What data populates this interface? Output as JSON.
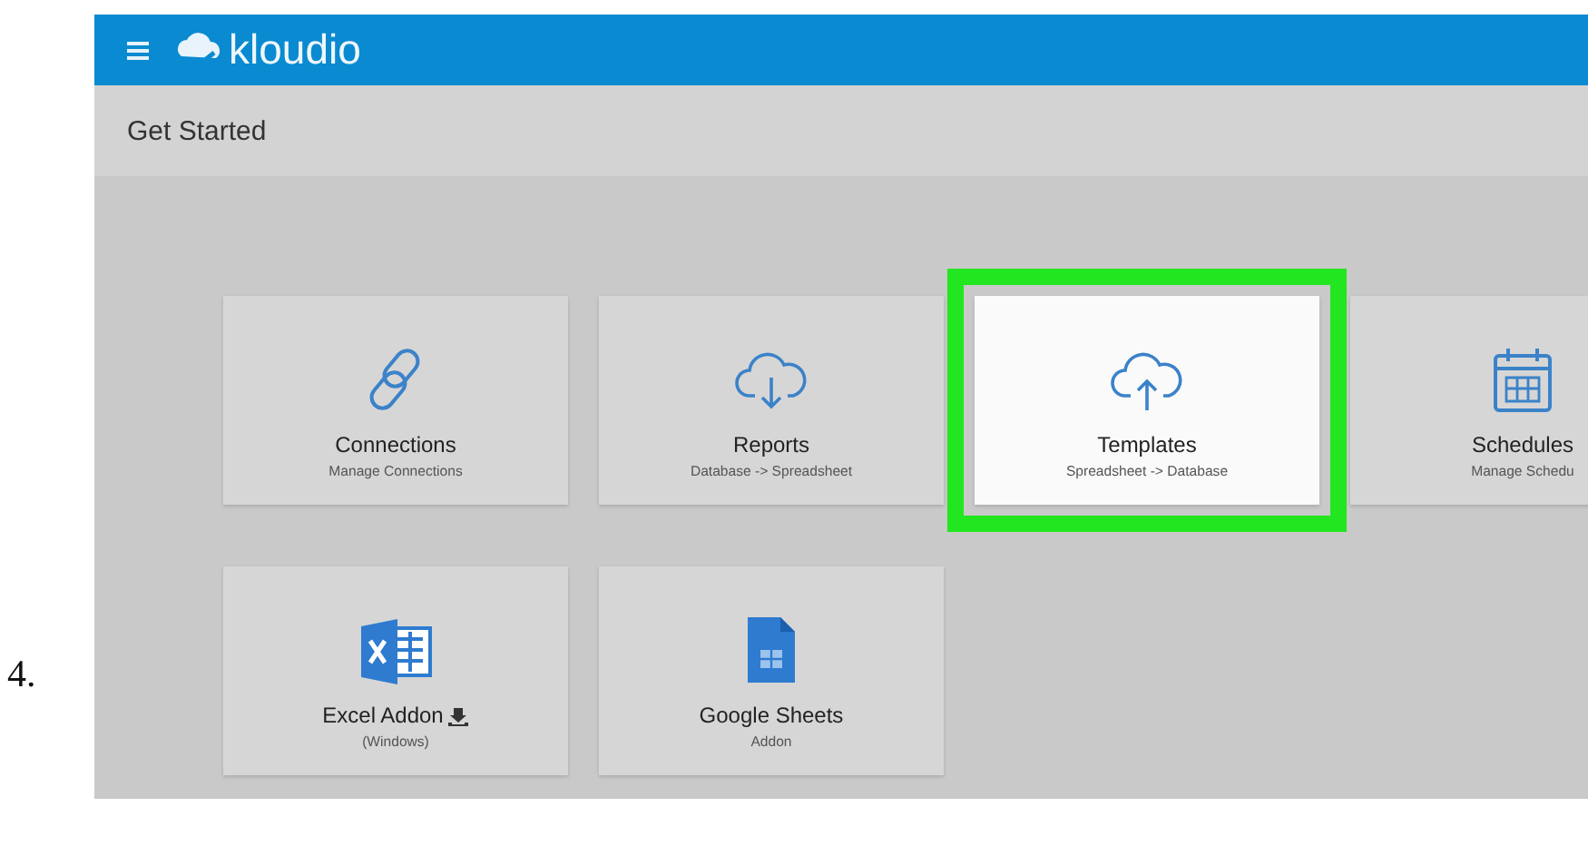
{
  "step_number": "4.",
  "app_bar": {
    "brand": "kloudio"
  },
  "page_title": "Get Started",
  "cards": [
    {
      "kind": "link",
      "title": "Connections",
      "subtitle": "Manage Connections",
      "selected": false,
      "download": false
    },
    {
      "kind": "cloud-down",
      "title": "Reports",
      "subtitle": "Database -> Spreadsheet",
      "selected": false,
      "download": false
    },
    {
      "kind": "cloud-up",
      "title": "Templates",
      "subtitle": "Spreadsheet -> Database",
      "selected": true,
      "download": false
    },
    {
      "kind": "calendar",
      "title": "Schedules",
      "subtitle": "Manage Schedu",
      "selected": false,
      "download": false
    },
    {
      "kind": "excel",
      "title": "Excel Addon",
      "subtitle": "(Windows)",
      "selected": false,
      "download": true
    },
    {
      "kind": "sheet",
      "title": "Google Sheets",
      "subtitle": "Addon",
      "selected": false,
      "download": false
    }
  ]
}
